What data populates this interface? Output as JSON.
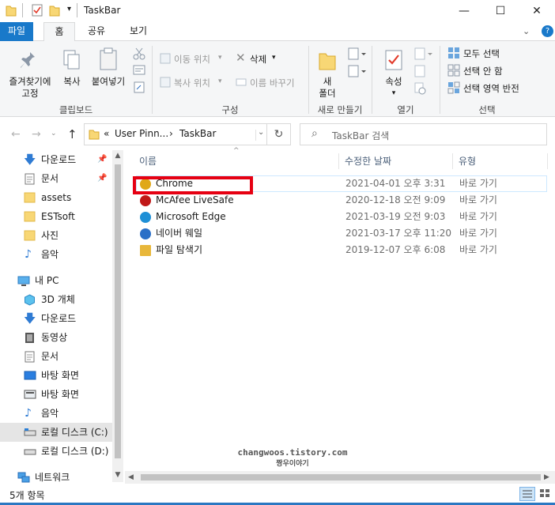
{
  "titlebar": {
    "title": "TaskBar",
    "minimize": "—",
    "maximize": "☐",
    "close": "✕"
  },
  "ribbon_tabs": [
    {
      "label": "파일"
    },
    {
      "label": "홈"
    },
    {
      "label": "공유"
    },
    {
      "label": "보기"
    }
  ],
  "ribbon": {
    "pin_label_1": "즐겨찾기에",
    "pin_label_2": "고정",
    "copy": "복사",
    "paste": "붙여넣기",
    "clipboard_group": "클립보드",
    "move_to": "이동 위치",
    "copy_to": "복사 위치",
    "delete": "삭제",
    "rename": "이름 바꾸기",
    "organize_group": "구성",
    "new_folder_1": "새",
    "new_folder_2": "폴더",
    "new_group": "새로 만들기",
    "properties": "속성",
    "open_group": "열기",
    "select_all": "모두 선택",
    "select_none": "선택 안 함",
    "invert_selection": "선택 영역 반전",
    "select_group": "선택"
  },
  "address": {
    "prefix": "«",
    "crumb1": "User Pinn...",
    "sep": "›",
    "crumb2": "TaskBar",
    "search_placeholder": "TaskBar 검색"
  },
  "nav": {
    "quick": [
      {
        "label": "다운로드",
        "pinned": true
      },
      {
        "label": "문서",
        "pinned": true
      },
      {
        "label": "assets"
      },
      {
        "label": "ESTsoft"
      },
      {
        "label": "사진"
      },
      {
        "label": "음악"
      }
    ],
    "pc_label": "내 PC",
    "pc": [
      {
        "label": "3D 개체"
      },
      {
        "label": "다운로드"
      },
      {
        "label": "동영상"
      },
      {
        "label": "문서"
      },
      {
        "label": "바탕 화면"
      },
      {
        "label": "바탕 화면"
      },
      {
        "label": "음악"
      },
      {
        "label": "로컬 디스크 (C:)"
      },
      {
        "label": "로컬 디스크 (D:)"
      }
    ],
    "network": "네트워크"
  },
  "columns": {
    "name": "이름",
    "modified": "수정한 날짜",
    "type": "유형"
  },
  "files": [
    {
      "name": "Chrome",
      "date": "2021-04-01 오후 3:31",
      "type": "바로 가기",
      "color": "#e0a818"
    },
    {
      "name": "McAfee LiveSafe",
      "date": "2020-12-18 오전 9:09",
      "type": "바로 가기",
      "color": "#c01818"
    },
    {
      "name": "Microsoft Edge",
      "date": "2021-03-19 오전 9:03",
      "type": "바로 가기",
      "color": "#1e8fd6"
    },
    {
      "name": "네이버 웨일",
      "date": "2021-03-17 오후 11:20",
      "type": "바로 가기",
      "color": "#2a6fc7"
    },
    {
      "name": "파일 탐색기",
      "date": "2019-12-07 오후 6:08",
      "type": "바로 가기",
      "color": "#e8b73a"
    }
  ],
  "highlight_color": "#e60012",
  "watermark": {
    "line1": "changwoos.tistory.com",
    "line2": "짱우이야기"
  },
  "status": {
    "count": "5개 항목"
  }
}
